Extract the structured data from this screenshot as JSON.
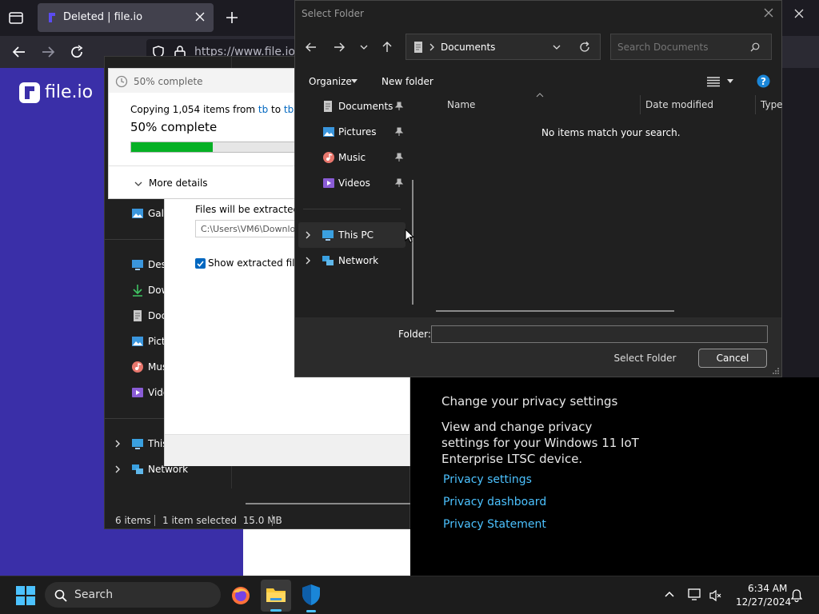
{
  "browser": {
    "tab_title": "Deleted | file.io",
    "url": "https://www.file.io/d",
    "logo_text": "file.io"
  },
  "privacy_panel": {
    "heading": "Change your privacy settings",
    "body": "View and change privacy settings for your Windows 11 IoT Enterprise LTSC device.",
    "links": [
      "Privacy settings",
      "Privacy dashboard",
      "Privacy Statement"
    ]
  },
  "explorer": {
    "nav_items": [
      "Gall",
      "Desk",
      "Dow",
      "Doc",
      "Pict",
      "Mus",
      "Vide"
    ],
    "this_pc": "This",
    "network": "Network",
    "status_items": "6 items",
    "status_selected": "1 item selected  15.0 MB"
  },
  "extract_wizard": {
    "dest_label": "Files will be extracted to",
    "dest_path": "C:\\Users\\VM6\\Downlo",
    "show_checkbox_label": "Show extracted files"
  },
  "progress_dialog": {
    "title": "50% complete",
    "copying_prefix": "Copying 1,054 items from ",
    "from": "tb",
    "to_word": " to ",
    "to": "tb",
    "percent_text": "50% complete",
    "progress": 0.5,
    "more_details": "More details"
  },
  "select_folder": {
    "title": "Select Folder",
    "breadcrumb": "Documents",
    "search_placeholder": "Search Documents",
    "organize": "Organize",
    "new_folder": "New folder",
    "nav": [
      {
        "label": "Documents",
        "icon": "documents-icon"
      },
      {
        "label": "Pictures",
        "icon": "pictures-icon"
      },
      {
        "label": "Music",
        "icon": "music-icon"
      },
      {
        "label": "Videos",
        "icon": "videos-icon"
      }
    ],
    "this_pc": "This PC",
    "network": "Network",
    "columns": [
      "Name",
      "Date modified",
      "Type"
    ],
    "empty_message": "No items match your search.",
    "folder_label": "Folder:",
    "folder_value": "",
    "select_button": "Select Folder",
    "cancel_button": "Cancel"
  },
  "taskbar": {
    "search_label": "Search",
    "time": "6:34 AM",
    "date": "12/27/2024"
  },
  "colors": {
    "accent": "#0078d4",
    "progress_green": "#06b025",
    "link": "#4cc2ff",
    "fileio_purple": "#3a2fa8"
  }
}
